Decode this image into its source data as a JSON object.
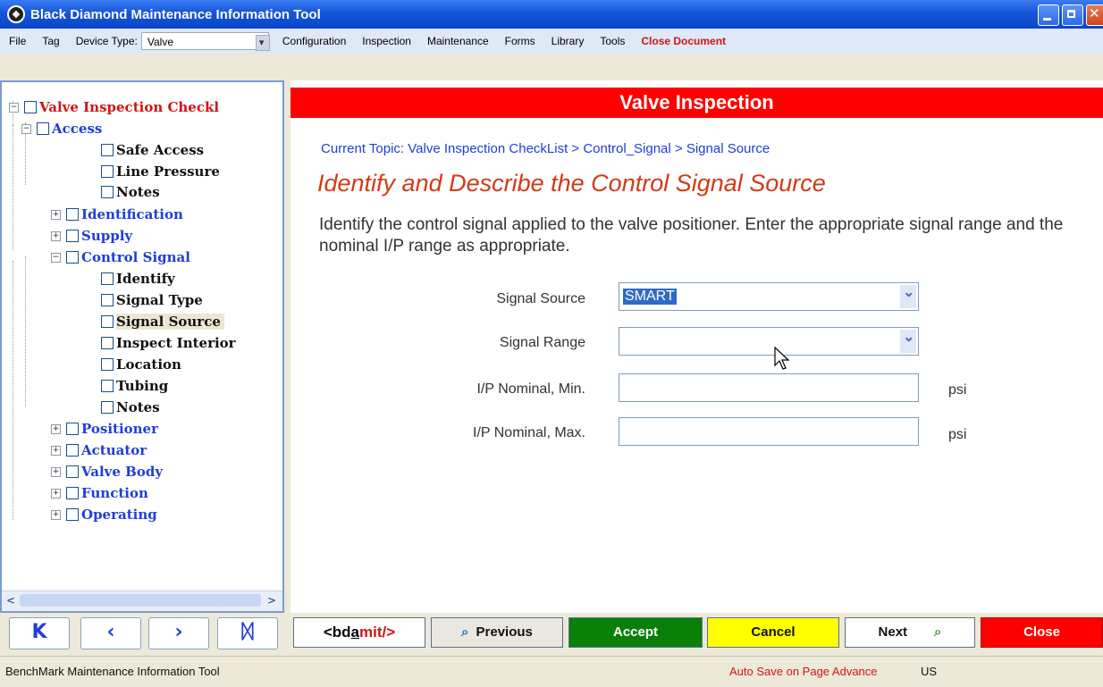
{
  "window": {
    "title": "Black Diamond Maintenance Information Tool"
  },
  "menu": {
    "items": [
      "File",
      "Tag"
    ],
    "device_type_label": "Device Type:",
    "device_type_value": "Valve",
    "right_items": [
      "Configuration",
      "Inspection",
      "Maintenance",
      "Forms",
      "Library",
      "Tools"
    ],
    "close_document": "Close Document"
  },
  "tree": {
    "root": "Valve Inspection Checkl",
    "access": "Access",
    "access_children": [
      "Safe Access",
      "Line Pressure",
      "Notes"
    ],
    "identification": "Identification",
    "supply": "Supply",
    "control_signal": "Control Signal",
    "control_children": [
      "Identify",
      "Signal Type",
      "Signal Source",
      "Inspect Interior",
      "Location",
      "Tubing",
      "Notes"
    ],
    "others": [
      "Positioner",
      "Actuator",
      "Valve Body",
      "Function",
      "Operating"
    ]
  },
  "main": {
    "header": "Valve Inspection",
    "topic": "Current Topic: Valve Inspection CheckList > Control_Signal > Signal Source",
    "heading": "Identify and Describe the Control Signal Source",
    "description": "Identify the control signal applied to the valve positioner. Enter the appropriate signal range and the nominal I/P range as appropriate."
  },
  "form": {
    "signal_source_label": "Signal Source",
    "signal_source_value": "SMART",
    "signal_range_label": "Signal Range",
    "signal_range_value": "",
    "ip_min_label": "I/P Nominal, Min.",
    "ip_min_value": "",
    "ip_max_label": "I/P Nominal, Max.",
    "ip_max_value": "",
    "unit": "psi"
  },
  "actions": {
    "bdsubmit": "<bd",
    "bdsubmit_a": "a",
    "bdsubmit_rest": "mit/>",
    "previous": "Previous",
    "accept": "Accept",
    "cancel": "Cancel",
    "next": "Next",
    "close": "Close"
  },
  "colors": {
    "header_red": "#ff0000",
    "accept_green": "#0a7f0a",
    "cancel_yellow": "#ffff00",
    "close_red": "#ff0000"
  },
  "status": {
    "app_name": "BenchMark Maintenance Information Tool",
    "auto_save": "Auto Save on Page Advance",
    "locale": "US"
  }
}
